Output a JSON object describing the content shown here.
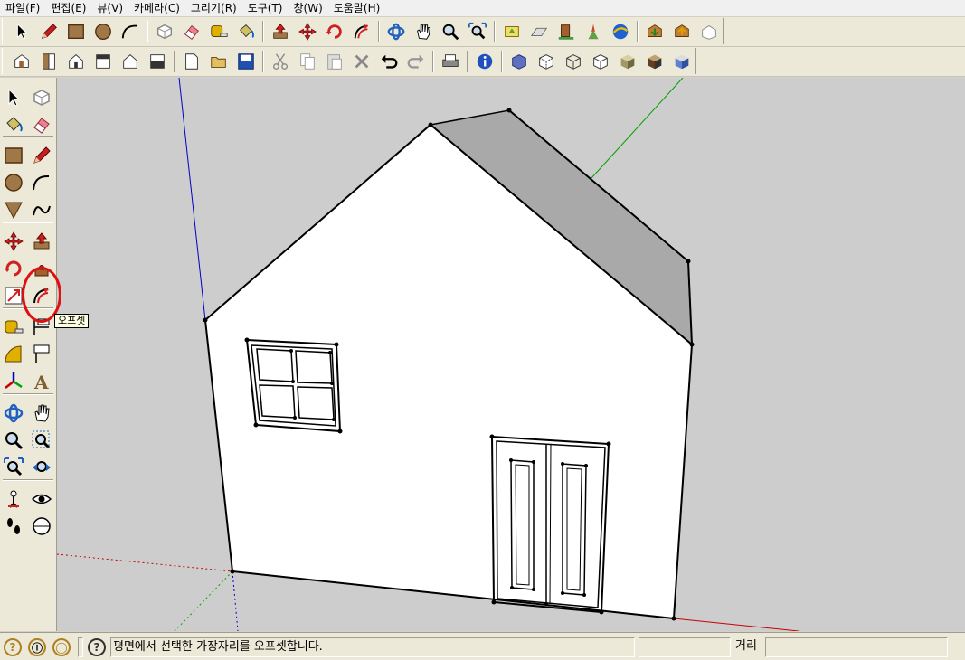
{
  "menu": [
    {
      "label": "파일(F)",
      "name": "menu-file"
    },
    {
      "label": "편집(E)",
      "name": "menu-edit"
    },
    {
      "label": "뷰(V)",
      "name": "menu-view"
    },
    {
      "label": "카메라(C)",
      "name": "menu-camera"
    },
    {
      "label": "그리기(R)",
      "name": "menu-draw"
    },
    {
      "label": "도구(T)",
      "name": "menu-tools"
    },
    {
      "label": "창(W)",
      "name": "menu-window"
    },
    {
      "label": "도움말(H)",
      "name": "menu-help"
    }
  ],
  "toolbar1": [
    "select-icon",
    "pencil-icon",
    "rectangle-icon",
    "circle-icon",
    "arc-icon",
    "sep",
    "make-component-icon",
    "eraser-icon",
    "tape-measure-icon",
    "paint-bucket-icon",
    "sep",
    "push-pull-icon",
    "move-icon",
    "rotate-icon",
    "offset-icon",
    "sep",
    "orbit-icon",
    "pan-icon",
    "zoom-icon",
    "zoom-extents-icon",
    "sep",
    "add-location-icon",
    "toggle-terrain-icon",
    "place-model-icon",
    "get-models-icon",
    "google-earth-icon",
    "sep",
    "get-models-warehouse-icon",
    "share-model-icon",
    "share-component-icon"
  ],
  "toolbar2": [
    "iso-view-icon",
    "top-view-icon",
    "front-view-icon",
    "right-view-icon",
    "back-view-icon",
    "left-view-icon",
    "sep",
    "new-file-icon",
    "open-file-icon",
    "save-file-icon",
    "sep",
    "cut-icon",
    "copy-icon",
    "paste-icon",
    "delete-icon",
    "undo-icon",
    "redo-icon",
    "sep",
    "print-icon",
    "sep",
    "model-info-icon",
    "sep",
    "xray-icon",
    "back-edges-icon",
    "wireframe-icon",
    "hidden-line-icon",
    "shaded-icon",
    "shaded-texture-icon",
    "monochrome-icon"
  ],
  "sidebar": [
    [
      "select-icon",
      "make-component-icon"
    ],
    [
      "paint-bucket-icon",
      "eraser-icon"
    ],
    [
      "rectangle-icon",
      "pencil-icon"
    ],
    [
      "circle-icon",
      "arc-icon"
    ],
    [
      "polygon-icon",
      "freehand-icon"
    ],
    [
      "move-icon",
      "push-pull-icon"
    ],
    [
      "rotate-icon",
      "follow-me-icon"
    ],
    [
      "scale-icon",
      "offset-icon"
    ],
    [
      "tape-measure-icon",
      "dimension-icon"
    ],
    [
      "protractor-icon",
      "text-icon"
    ],
    [
      "axes-icon",
      "3d-text-icon"
    ],
    [
      "orbit-icon",
      "pan-icon"
    ],
    [
      "zoom-icon",
      "zoom-window-icon"
    ],
    [
      "zoom-extents-icon",
      "previous-view-icon"
    ],
    [
      "position-camera-icon",
      "look-around-icon"
    ],
    [
      "walk-icon",
      "section-plane-icon"
    ]
  ],
  "tooltip": "오프셋",
  "status": {
    "message": "평면에서 선택한 가장자리를 오프셋합니다.",
    "measure_label": "거리",
    "measure_value": ""
  },
  "colors": {
    "viewport_bg": "#cdcdcd",
    "wall_face": "#ffffff",
    "roof_face": "#a9a9a9",
    "axis_blue": "#0000c8",
    "axis_green": "#00a000",
    "axis_red": "#c80000",
    "highlight": "#e01010"
  }
}
